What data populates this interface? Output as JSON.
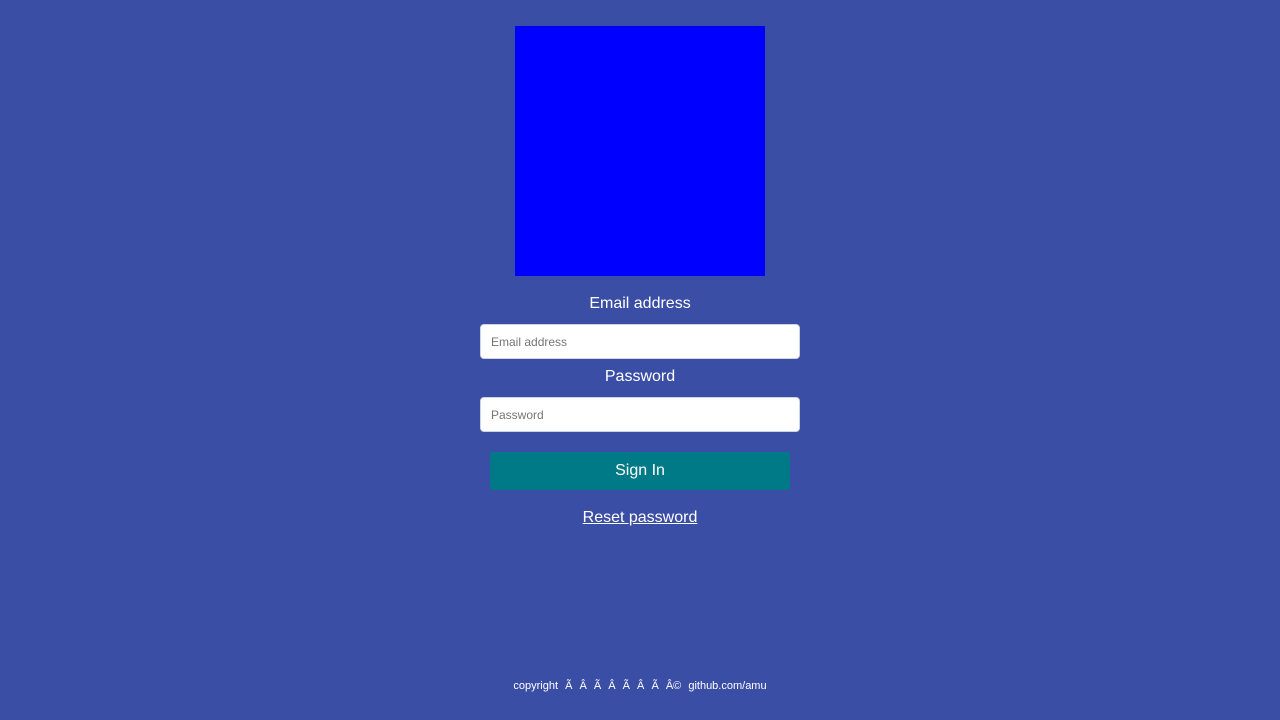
{
  "colors": {
    "background": "#3b4ea5",
    "logo": "#0000ff",
    "sign_in_button": "#007a87",
    "text": "#ffffff"
  },
  "form": {
    "email_label": "Email address",
    "email_placeholder": "Email address",
    "email_value": "",
    "password_label": "Password",
    "password_placeholder": "Password",
    "password_value": "",
    "sign_in_label": "Sign In",
    "reset_password_label": "Reset password"
  },
  "footer": {
    "text": "copyright Ã  Â  Ã  Â  Ã  Â  Ã  Â© github.com/amu"
  }
}
